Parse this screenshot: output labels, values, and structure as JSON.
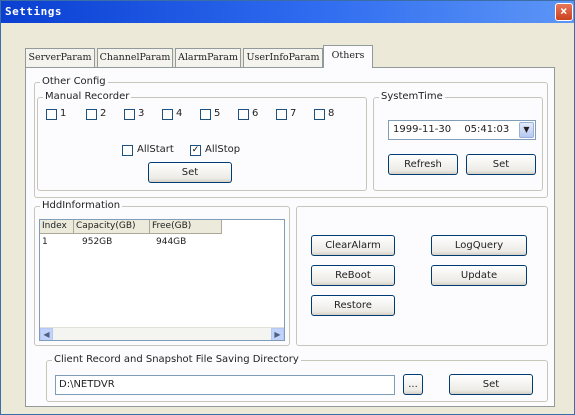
{
  "window": {
    "title": "Settings",
    "close_glyph": "×"
  },
  "tabs": [
    {
      "label": "ServerParam"
    },
    {
      "label": "ChannelParam"
    },
    {
      "label": "AlarmParam"
    },
    {
      "label": "UserInfoParam"
    },
    {
      "label": "Others"
    }
  ],
  "other_config": {
    "legend": "Other Config",
    "manual_recorder": {
      "legend": "Manual Recorder",
      "channels": [
        {
          "label": "1",
          "checked": false
        },
        {
          "label": "2",
          "checked": false
        },
        {
          "label": "3",
          "checked": false
        },
        {
          "label": "4",
          "checked": false
        },
        {
          "label": "5",
          "checked": false
        },
        {
          "label": "6",
          "checked": false
        },
        {
          "label": "7",
          "checked": false
        },
        {
          "label": "8",
          "checked": false
        }
      ],
      "all_start": {
        "label": "AllStart",
        "checked": false
      },
      "all_stop": {
        "label": "AllStop",
        "checked": true
      },
      "set_label": "Set"
    },
    "system_time": {
      "legend": "SystemTime",
      "date": "1999-11-30",
      "time": "05:41:03",
      "refresh_label": "Refresh",
      "set_label": "Set"
    }
  },
  "hdd": {
    "legend": "HddInformation",
    "columns": [
      "Index",
      "Capacity(GB)",
      "Free(GB)"
    ],
    "rows": [
      {
        "index": "1",
        "capacity": "952GB",
        "free": "944GB"
      }
    ]
  },
  "actions": {
    "clear_alarm": "ClearAlarm",
    "log_query": "LogQuery",
    "reboot": "ReBoot",
    "update": "Update",
    "restore": "Restore"
  },
  "client_dir": {
    "legend": "Client Record and Snapshot File Saving Directory",
    "path": "D:\\NETDVR",
    "browse_label": "...",
    "set_label": "Set"
  },
  "icons": {
    "checkmark": "✓",
    "dropdown": "▼",
    "scroll_left": "◀",
    "scroll_right": "▶"
  }
}
